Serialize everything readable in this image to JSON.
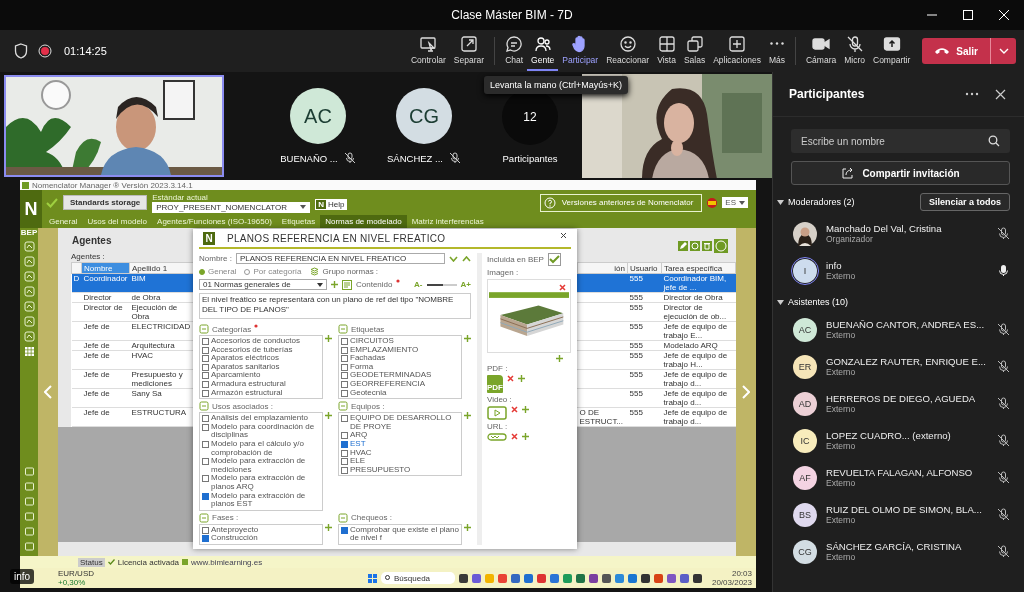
{
  "window": {
    "title": "Clase Máster BIM - 7D"
  },
  "meeting": {
    "elapsed": "01:14:25",
    "recording": true
  },
  "toolbar": {
    "groups": [
      [
        {
          "kind": "control",
          "label": "Controlar",
          "selected": false,
          "hovered": false
        },
        {
          "kind": "separate",
          "label": "Separar",
          "selected": false,
          "hovered": false
        }
      ],
      [
        {
          "kind": "chat",
          "label": "Chat",
          "selected": false,
          "hovered": false
        },
        {
          "kind": "people",
          "label": "Gente",
          "selected": true,
          "hovered": false
        },
        {
          "kind": "hand",
          "label": "Participar",
          "selected": false,
          "hovered": true
        },
        {
          "kind": "react",
          "label": "Reaccionar",
          "selected": false,
          "hovered": false
        },
        {
          "kind": "view",
          "label": "Vista",
          "selected": false,
          "hovered": false
        },
        {
          "kind": "rooms",
          "label": "Salas",
          "selected": false,
          "hovered": false
        },
        {
          "kind": "apps",
          "label": "Aplicaciones",
          "selected": false,
          "hovered": false
        },
        {
          "kind": "more",
          "label": "Más",
          "selected": false,
          "hovered": false
        }
      ],
      [
        {
          "kind": "camera",
          "label": "Cámara",
          "selected": false,
          "hovered": false
        },
        {
          "kind": "mic",
          "label": "Micro",
          "selected": false,
          "hovered": false
        },
        {
          "kind": "share",
          "label": "Compartir",
          "selected": false,
          "hovered": false
        }
      ]
    ],
    "leave_button": "Salir"
  },
  "tooltip": "Levanta la mano (Ctrl+Mayús+K)",
  "stage": {
    "tiles": [
      {
        "kind": "video",
        "speaking": true
      },
      {
        "kind": "avatar",
        "initials": "AC",
        "name": "BUENAÑO ...",
        "muted": true,
        "color": "#cfe8d7"
      },
      {
        "kind": "avatar",
        "initials": "CG",
        "name": "SÁNCHEZ ...",
        "muted": true,
        "color": "#d3dde3"
      },
      {
        "kind": "count",
        "count": "12",
        "name": "Participantes"
      },
      {
        "kind": "video",
        "speaking": false
      }
    ]
  },
  "shared_app": {
    "title": "Nomenclator Manager ® Versión 2023.3.14.1",
    "logo": "N",
    "storage_button": "Standards storage",
    "current_label": "Estándar actual",
    "current_value": "PROY_PRESENT_NOMENCLATOR",
    "help_logo": "N",
    "help_button": "Help",
    "versions_button": "Versiones anteriores de Nomenclator",
    "language": "ES",
    "section": "BEP",
    "tabs": [
      {
        "label": "General",
        "selected": false
      },
      {
        "label": "Usos del modelo",
        "selected": false
      },
      {
        "label": "Agentes/Funciones (ISO-19650)",
        "selected": false
      },
      {
        "label": "Etiquetas",
        "selected": false
      },
      {
        "label": "Normas de modelado",
        "selected": true
      },
      {
        "label": "Matriz interferencias",
        "selected": false
      }
    ],
    "heading": "Agentes",
    "table_label": "Agentes :",
    "table": {
      "columns": [
        "Nombre",
        "Apellido 1",
        "ión",
        "Usuario",
        "Tarea específica"
      ],
      "rows": [
        {
          "marker": "D",
          "cells": [
            "Coordinador",
            "BIM",
            "",
            "555",
            "Coordinador BIM, jefe de ..."
          ],
          "selected": true
        },
        {
          "marker": "",
          "cells": [
            "Director",
            "de Obra",
            "",
            "555",
            "Director de Obra"
          ],
          "selected": false
        },
        {
          "marker": "",
          "cells": [
            "Director de",
            "Ejecución de Obra",
            "",
            "555",
            "Director de ejecución de ob..."
          ],
          "selected": false
        },
        {
          "marker": "",
          "cells": [
            "Jefe de",
            "ELECTRICIDAD",
            "",
            "555",
            "Jefe de equipo de trabajo E..."
          ],
          "selected": false
        },
        {
          "marker": "",
          "cells": [
            "Jefe de",
            "Arquitectura",
            "",
            "555",
            "Modelado ARQ"
          ],
          "selected": false
        },
        {
          "marker": "",
          "cells": [
            "Jefe de",
            "HVAC",
            "",
            "555",
            "Jefe de equipo de trabajo H..."
          ],
          "selected": false
        },
        {
          "marker": "",
          "cells": [
            "Jefe de",
            "Presupuesto y mediciones",
            "",
            "555",
            "Jefe de equipo de trabajo d..."
          ],
          "selected": false
        },
        {
          "marker": "",
          "cells": [
            "Jefe de",
            "Sany Sa",
            "",
            "555",
            "Jefe de equipo de trabajo d..."
          ],
          "selected": false
        },
        {
          "marker": "",
          "cells": [
            "Jefe de",
            "ESTRUCTURA",
            "O DE ESTRUCT...",
            "555",
            "Jefe de equipo de trabajo d..."
          ],
          "selected": false
        }
      ]
    },
    "dialog": {
      "logo": "N",
      "title": "PLANOS REFERENCIA EN NIVEL FREATICO",
      "name_label": "Nombre :",
      "name_value": "PLANOS REFERENCIA EN NIVEL FREATICO",
      "scope": [
        {
          "label": "General",
          "selected": true
        },
        {
          "label": "Por categoría",
          "selected": false
        }
      ],
      "group_label": "Grupo normas :",
      "group_value": "01 Normas generales de",
      "content_label": "Contenido",
      "font_smaller": "A-",
      "font_larger": "A+",
      "font_size_slider": {
        "level": 0.55
      },
      "content": "El nivel freático se representará con un plano de ref del tipo \"NOMBRE DEL TIPO DE PLANOS\"",
      "lists": [
        {
          "kind": "categories",
          "title": "Categorías",
          "required": true,
          "items": [
            {
              "label": "Accesorios de conductos",
              "checked": false
            },
            {
              "label": "Accesorios de tuberías",
              "checked": false
            },
            {
              "label": "Aparatos eléctricos",
              "checked": false
            },
            {
              "label": "Aparatos sanitarios",
              "checked": false
            },
            {
              "label": "Aparcamiento",
              "checked": false
            },
            {
              "label": "Armadura estructural",
              "checked": false
            },
            {
              "label": "Armazón estructural",
              "checked": false
            }
          ]
        },
        {
          "kind": "tags",
          "title": "Etiquetas",
          "required": false,
          "items": [
            {
              "label": "CIRCUITOS",
              "checked": false
            },
            {
              "label": "EMPLAZAMIENTO",
              "checked": false
            },
            {
              "label": "Fachadas",
              "checked": false
            },
            {
              "label": "Forma",
              "checked": false
            },
            {
              "label": "GEODETERMINADAS",
              "checked": false
            },
            {
              "label": "GEORREFERENCIA",
              "checked": false
            },
            {
              "label": "Geotecnia",
              "checked": false
            }
          ]
        },
        {
          "kind": "uses",
          "title": "Usos asociados :",
          "required": false,
          "items": [
            {
              "label": "Análisis del emplazamiento",
              "checked": false
            },
            {
              "label": "Modelo para coordinación de disciplinas",
              "checked": false
            },
            {
              "label": "Modelo para el cálculo y/o comprobación de",
              "checked": false
            },
            {
              "label": "Modelo para extracción de mediciones",
              "checked": false
            },
            {
              "label": "Modelo para extracción de planos ARQ",
              "checked": false
            },
            {
              "label": "Modelo para extracción de planos EST",
              "checked": true
            }
          ]
        },
        {
          "kind": "teams",
          "title": "Equipos :",
          "required": false,
          "items": [
            {
              "label": "EQUIPO DE DESARROLLO DE PROYE",
              "checked": false
            },
            {
              "label": "ARQ",
              "checked": false
            },
            {
              "label": "EST",
              "checked": true
            },
            {
              "label": "HVAC",
              "checked": false
            },
            {
              "label": "ELE",
              "checked": false
            },
            {
              "label": "PRESUPUESTO",
              "checked": false
            }
          ]
        },
        {
          "kind": "phases",
          "title": "Fases :",
          "required": false,
          "items": [
            {
              "label": "Anteproyecto",
              "checked": false
            },
            {
              "label": "Construcción",
              "checked": true
            }
          ]
        },
        {
          "kind": "checks",
          "title": "Chequeos :",
          "required": false,
          "items": [
            {
              "label": "Comprobar que existe el plano de nivel f",
              "checked": true
            }
          ]
        }
      ],
      "bep_label": "Incluida en BEP",
      "in_bep": true,
      "image_label": "Imagen :",
      "pdf_label": "PDF :",
      "pdf_badge": "PDF",
      "video_label": "Video :",
      "url_label": "URL :"
    },
    "status": "Status",
    "license": "Licencia activada",
    "website": "www.bimlearning.es",
    "taskbar": {
      "ticker": "EUR/USD",
      "change": "+0,30%",
      "search": "Búsqueda",
      "time": "20:03",
      "date": "20/03/2023"
    }
  },
  "overlay_name": "info",
  "panel": {
    "title": "Participantes",
    "search_placeholder": "Escribe un nombre",
    "invite_button": "Compartir invitación",
    "sections": [
      {
        "title": "Moderadores (2)",
        "expanded": true,
        "action": "Silenciar a todos",
        "members": [
          {
            "name": "Manchado Del Val, Cristina",
            "role": "Organizador",
            "muted": true,
            "speaking": false
          },
          {
            "kind": "initials",
            "initials": "I",
            "color": "#cddcee",
            "name": "info",
            "role": "Externo",
            "muted": false,
            "speaking": true
          }
        ]
      },
      {
        "title": "Asistentes (10)",
        "expanded": true,
        "members": [
          {
            "kind": "initials",
            "initials": "AC",
            "color": "#cfe8d7",
            "name": "BUENAÑO CANTOR, ANDREA ES...",
            "role": "Externo",
            "muted": true,
            "speaking": false
          },
          {
            "kind": "initials",
            "initials": "ER",
            "color": "#f6e5b8",
            "name": "GONZALEZ RAUTER, ENRIQUE E...",
            "role": "Externo",
            "muted": true,
            "speaking": false
          },
          {
            "kind": "initials",
            "initials": "AD",
            "color": "#ecd0d6",
            "name": "HERREROS DE DIEGO, AGUEDA",
            "role": "Externo",
            "muted": true,
            "speaking": false
          },
          {
            "kind": "initials",
            "initials": "IC",
            "color": "#f8ecbc",
            "name": "LOPEZ CUADRO...  (externo)",
            "role": "Externo",
            "muted": true,
            "speaking": false
          },
          {
            "kind": "initials",
            "initials": "AF",
            "color": "#f3d3e2",
            "name": "REVUELTA FALAGAN, ALFONSO",
            "role": "Externo",
            "muted": true,
            "speaking": false
          },
          {
            "kind": "initials",
            "initials": "BS",
            "color": "#dfd9ee",
            "name": "RUIZ DEL OLMO DE SIMON, BLA...",
            "role": "Externo",
            "muted": true,
            "speaking": false
          },
          {
            "kind": "initials",
            "initials": "CG",
            "color": "#d3dde3",
            "name": "SÁNCHEZ GARCÍA, CRISTINA",
            "role": "Externo",
            "muted": true,
            "speaking": false
          }
        ]
      }
    ]
  }
}
